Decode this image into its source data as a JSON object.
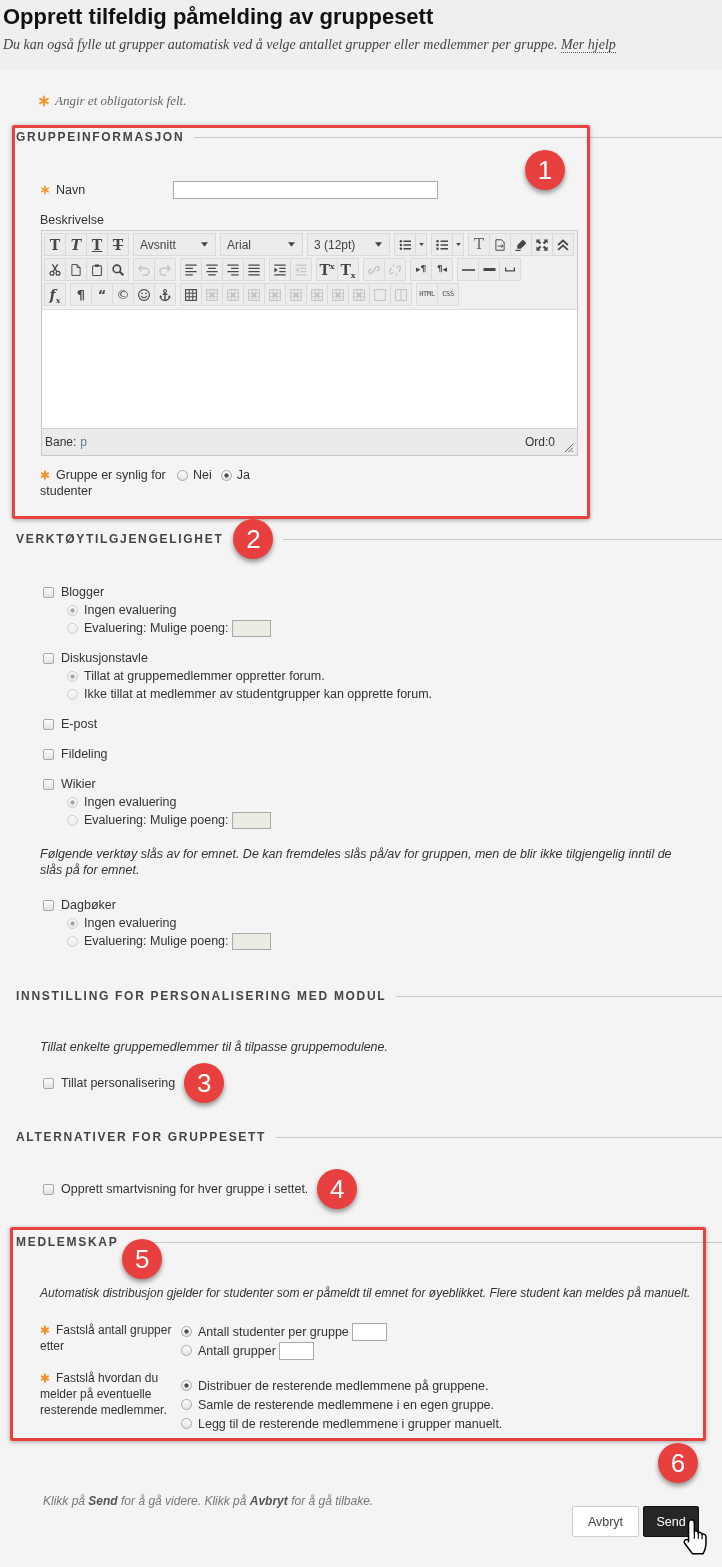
{
  "header": {
    "title": "Opprett tilfeldig påmelding av gruppesett",
    "description": "Du kan også fylle ut grupper automatisk ved å velge antallet grupper eller medlemmer per gruppe.",
    "help_link": "Mer hjelp"
  },
  "required_note": "Angir et obligatorisk felt.",
  "sections": [
    {
      "kind": "group-info",
      "heading": "GRUPPEINFORMASJON",
      "highlighted": true,
      "badge": "1",
      "name_field": {
        "label": "Navn",
        "required": true
      },
      "description": {
        "label": "Beskrivelse",
        "required": false
      },
      "editor": {
        "toolbar": [
          [
            [
              {
                "kind": "bold",
                "label": "T",
                "disabled": false
              },
              {
                "kind": "italic",
                "label": "T",
                "disabled": false
              },
              {
                "kind": "underline",
                "label": "T",
                "disabled": false
              },
              {
                "kind": "strike",
                "label": "T",
                "disabled": false
              }
            ],
            [
              {
                "kind": "select",
                "label": "Avsnitt",
                "disabled": false
              }
            ],
            [
              {
                "kind": "select",
                "label": "Arial",
                "disabled": false
              }
            ],
            [
              {
                "kind": "select",
                "label": "3 (12pt)",
                "disabled": false
              }
            ],
            [
              {
                "kind": "bullets",
                "disabled": false
              },
              {
                "kind": "menu-caret",
                "disabled": false
              }
            ],
            [
              {
                "kind": "numbers",
                "disabled": false
              },
              {
                "kind": "menu-caret",
                "disabled": false
              }
            ],
            [
              {
                "kind": "plain-text",
                "label": "T",
                "disabled": false
              },
              {
                "kind": "paste-text",
                "disabled": false
              },
              {
                "kind": "highlight",
                "disabled": false
              },
              {
                "kind": "fullscreen",
                "disabled": false
              },
              {
                "kind": "collapse",
                "disabled": false
              }
            ]
          ],
          [
            [
              {
                "kind": "cut",
                "disabled": false
              },
              {
                "kind": "copy",
                "disabled": false
              },
              {
                "kind": "paste",
                "disabled": false
              },
              {
                "kind": "find",
                "disabled": false
              }
            ],
            [
              {
                "kind": "undo",
                "disabled": true
              },
              {
                "kind": "redo",
                "disabled": true
              }
            ],
            [
              {
                "kind": "align-left",
                "disabled": false
              },
              {
                "kind": "align-center",
                "disabled": false
              },
              {
                "kind": "align-right",
                "disabled": false
              },
              {
                "kind": "justify",
                "disabled": false
              }
            ],
            [
              {
                "kind": "indent",
                "disabled": false
              },
              {
                "kind": "outdent",
                "disabled": true
              }
            ],
            [
              {
                "kind": "superscript",
                "label": "T$^{x}$",
                "disabled": false
              },
              {
                "kind": "subscript",
                "label": "T$_{x}$",
                "disabled": false
              }
            ],
            [
              {
                "kind": "link",
                "disabled": true
              },
              {
                "kind": "unlink",
                "disabled": true
              }
            ],
            [
              {
                "kind": "ltr",
                "label": "▸¶",
                "disabled": false
              },
              {
                "kind": "rtl",
                "label": "¶◂",
                "disabled": false
              }
            ],
            [
              {
                "kind": "rule-thin",
                "disabled": false
              },
              {
                "kind": "rule-thick",
                "disabled": false
              },
              {
                "kind": "nbsp",
                "disabled": false
              }
            ]
          ],
          [
            [
              {
                "kind": "formula",
                "label": "f$_{x}$",
                "disabled": false
              }
            ],
            [
              {
                "kind": "pilcrow",
                "label": "¶",
                "disabled": false
              },
              {
                "kind": "quote",
                "label": "“",
                "disabled": false
              },
              {
                "kind": "copyright",
                "label": "©",
                "disabled": false
              },
              {
                "kind": "smiley",
                "disabled": false
              },
              {
                "kind": "anchor",
                "disabled": false
              }
            ],
            [
              {
                "kind": "table",
                "disabled": false
              },
              {
                "kind": "table-op",
                "disabled": true
              },
              {
                "kind": "table-op",
                "disabled": true
              },
              {
                "kind": "table-op",
                "disabled": true
              },
              {
                "kind": "table-op",
                "disabled": true
              },
              {
                "kind": "table-op",
                "disabled": true
              },
              {
                "kind": "table-op",
                "disabled": true
              },
              {
                "kind": "table-op",
                "disabled": true
              },
              {
                "kind": "table-op",
                "disabled": true
              },
              {
                "kind": "cell",
                "disabled": true
              },
              {
                "kind": "split-cell",
                "disabled": true
              }
            ],
            [
              {
                "kind": "html",
                "label": "HTML",
                "disabled": false
              },
              {
                "kind": "css",
                "label": "CSS",
                "disabled": false
              }
            ]
          ]
        ],
        "path_label": "Bane:",
        "path": "p",
        "word_count": "Ord:0"
      },
      "visibility": {
        "label": "Gruppe er synlig for studenter",
        "required": true,
        "options": [
          {
            "label": "Nei",
            "selected": false
          },
          {
            "label": "Ja",
            "selected": true
          }
        ]
      }
    },
    {
      "kind": "tools",
      "heading": "VERKTØYTILGJENGELIGHET",
      "highlighted": false,
      "badge": "2",
      "items": [
        {
          "kind": "tool",
          "label": "Blogger",
          "checked": false,
          "options": [
            {
              "kind": "plain",
              "label": "Ingen evaluering",
              "selected": true,
              "disabled": true
            },
            {
              "kind": "field",
              "label": "Evaluering: Mulige poeng:",
              "selected": false,
              "disabled": true
            }
          ]
        },
        {
          "kind": "tool",
          "label": "Diskusjonstavle",
          "checked": false,
          "options": [
            {
              "kind": "plain",
              "label": "Tillat at gruppemedlemmer oppretter forum.",
              "selected": true,
              "disabled": true
            },
            {
              "kind": "plain",
              "label": "Ikke tillat at medlemmer av studentgrupper kan opprette forum.",
              "selected": false,
              "disabled": true
            }
          ]
        },
        {
          "kind": "tool",
          "label": "E-post",
          "checked": false
        },
        {
          "kind": "tool",
          "label": "Fildeling",
          "checked": false
        },
        {
          "kind": "tool",
          "label": "Wikier",
          "checked": false,
          "options": [
            {
              "kind": "plain",
              "label": "Ingen evaluering",
              "selected": true,
              "disabled": true
            },
            {
              "kind": "field",
              "label": "Evaluering: Mulige poeng:",
              "selected": false,
              "disabled": true
            }
          ]
        },
        {
          "kind": "note",
          "text": "Følgende verktøy slås av for emnet. De kan fremdeles slås på/av for gruppen, men de blir ikke tilgjengelig inntil de slås på for emnet."
        },
        {
          "kind": "tool",
          "label": "Dagbøker",
          "checked": false,
          "options": [
            {
              "kind": "plain",
              "label": "Ingen evaluering",
              "selected": true,
              "disabled": true
            },
            {
              "kind": "field",
              "label": "Evaluering: Mulige poeng:",
              "selected": false,
              "disabled": true
            }
          ]
        }
      ]
    },
    {
      "kind": "personalization",
      "heading": "INNSTILLING FOR PERSONALISERING MED MODUL",
      "highlighted": false,
      "note": "Tillat enkelte gruppemedlemmer til å tilpasse gruppemodulene.",
      "checkbox": {
        "label": "Tillat personalisering",
        "checked": false,
        "badge": "3"
      }
    },
    {
      "kind": "groupset",
      "heading": "ALTERNATIVER FOR GRUPPESETT",
      "highlighted": false,
      "checkbox": {
        "label": "Opprett smartvisning for hver gruppe i settet.",
        "checked": false,
        "badge": "4"
      }
    },
    {
      "kind": "membership",
      "heading": "MEDLEMSKAP",
      "highlighted": true,
      "badge": "5",
      "note": "Automatisk distribusjon gjelder for studenter som er påmeldt til emnet for øyeblikket. Flere student kan meldes på manuelt.",
      "rows": [
        {
          "label": "Fastslå antall grupper etter",
          "required": true,
          "options": [
            {
              "kind": "field",
              "label": "Antall studenter per gruppe",
              "selected": true,
              "disabled": false
            },
            {
              "kind": "field",
              "label": "Antall grupper",
              "selected": false,
              "disabled": false
            }
          ]
        },
        {
          "label": "Fastslå hvordan du melder på eventuelle resterende medlemmer.",
          "required": true,
          "options": [
            {
              "kind": "plain",
              "label": "Distribuer de resterende medlemmene på gruppene.",
              "selected": true,
              "disabled": false
            },
            {
              "kind": "plain",
              "label": "Samle de resterende medlemmene i en egen gruppe.",
              "selected": false,
              "disabled": false
            },
            {
              "kind": "plain",
              "label": "Legg til de resterende medlemmene i grupper manuelt.",
              "selected": false,
              "disabled": false
            }
          ]
        }
      ]
    }
  ],
  "footer": {
    "hint": "Klikk på **Send** for å gå videre. Klikk på **Avbryt** for å gå tilbake.",
    "buttons": [
      {
        "kind": "cancel",
        "label": "Avbryt",
        "hovered": false
      },
      {
        "kind": "submit",
        "label": "Send",
        "hovered": true,
        "badge": "6"
      }
    ]
  }
}
